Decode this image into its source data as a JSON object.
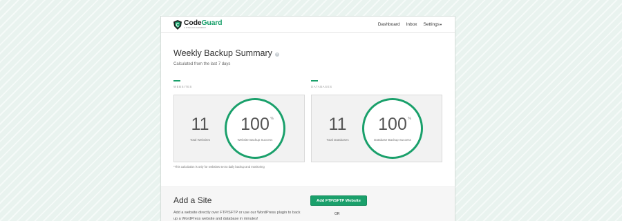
{
  "brand": {
    "name_prefix": "Code",
    "name_suffix": "Guard",
    "tagline": "A SITELOCK COMPANY"
  },
  "nav": {
    "dashboard": "Dashboard",
    "inbox": "Inbox",
    "settings": "Settings"
  },
  "page": {
    "title": "Weekly Backup Summary",
    "subtitle": "Calculated from the last 7 days"
  },
  "websites": {
    "section_label": "WEBSITES",
    "count": "11",
    "count_label": "Total Websites",
    "percent": "100",
    "percent_sign": "%",
    "percent_label": "Website Backup Success"
  },
  "databases": {
    "section_label": "DATABASES",
    "count": "11",
    "count_label": "Total Databases",
    "percent": "100",
    "percent_sign": "%",
    "percent_label": "Database Backup Success"
  },
  "footnote": "*This calculation is only for websites set to daily backup and monitoring",
  "add_site": {
    "title": "Add a Site",
    "description": "Add a website directly over FTP/SFTP or use our WordPress plugin to back up a WordPress website and database in minutes!",
    "button": "Add FTP/SFTP Website",
    "or": "OR"
  },
  "colors": {
    "accent": "#1aa06b",
    "background": "#e9f3ef"
  }
}
